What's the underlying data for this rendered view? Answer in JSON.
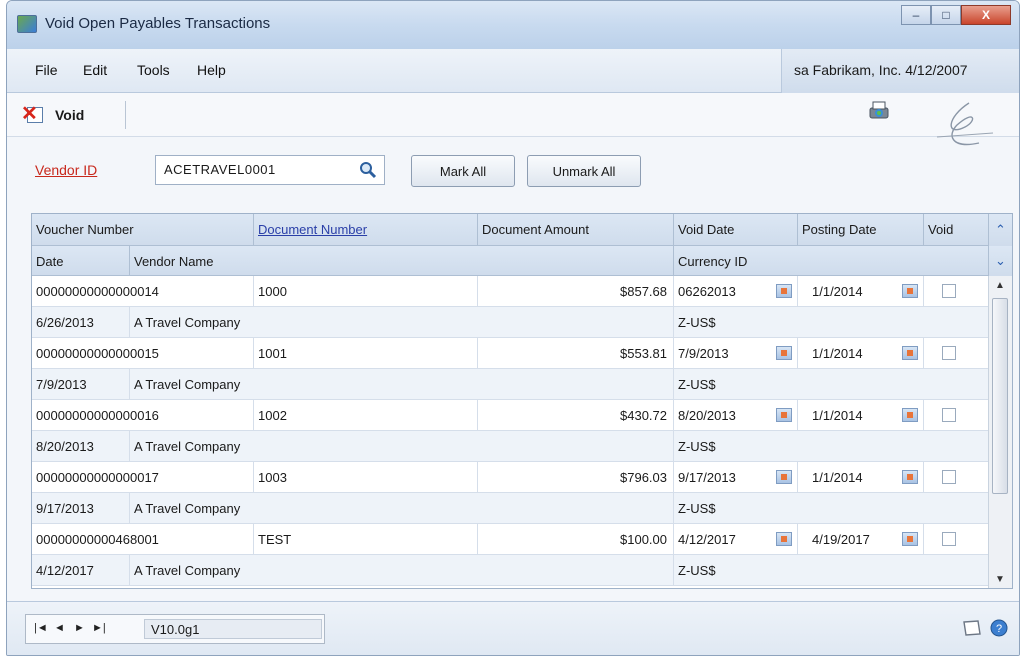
{
  "window": {
    "title": "Void Open Payables Transactions",
    "controls": {
      "minimize": "–",
      "maximize": "□",
      "close": "X"
    }
  },
  "menu": {
    "items": [
      "File",
      "Edit",
      "Tools",
      "Help"
    ],
    "company_info": "sa  Fabrikam, Inc.  4/12/2007"
  },
  "toolbar": {
    "void_label": "Void"
  },
  "vendor": {
    "label": "Vendor ID",
    "value": "ACETRAVEL0001",
    "mark_all": "Mark All",
    "unmark_all": "Unmark All"
  },
  "grid": {
    "header1": [
      "Voucher Number",
      "Document Number",
      "Document Amount",
      "Void Date",
      "Posting Date",
      "Void"
    ],
    "header2": [
      "Date",
      "Vendor Name",
      "Currency ID"
    ],
    "rows": [
      {
        "voucher": "00000000000000014",
        "document": "1000",
        "amount": "$857.68",
        "void_date": "06262013",
        "posting_date": "1/1/2014",
        "date": "6/26/2013",
        "vendor_name": "A Travel Company",
        "currency": "Z-US$"
      },
      {
        "voucher": "00000000000000015",
        "document": "1001",
        "amount": "$553.81",
        "void_date": "7/9/2013",
        "posting_date": "1/1/2014",
        "date": "7/9/2013",
        "vendor_name": "A Travel Company",
        "currency": "Z-US$"
      },
      {
        "voucher": "00000000000000016",
        "document": "1002",
        "amount": "$430.72",
        "void_date": "8/20/2013",
        "posting_date": "1/1/2014",
        "date": "8/20/2013",
        "vendor_name": "A Travel Company",
        "currency": "Z-US$"
      },
      {
        "voucher": "00000000000000017",
        "document": "1003",
        "amount": "$796.03",
        "void_date": "9/17/2013",
        "posting_date": "1/1/2014",
        "date": "9/17/2013",
        "vendor_name": "A Travel Company",
        "currency": "Z-US$"
      },
      {
        "voucher": "00000000000468001",
        "document": "TEST",
        "amount": "$100.00",
        "void_date": "4/12/2017",
        "posting_date": "4/19/2017",
        "date": "4/12/2017",
        "vendor_name": "A Travel Company",
        "currency": "Z-US$"
      }
    ]
  },
  "status": {
    "nav": {
      "first": "|◄",
      "prev": "◄",
      "next": "►",
      "last": "►|"
    },
    "version": "V10.0g1"
  },
  "colors": {
    "accent": "#2a3fa8",
    "vendor_label": "#c8281c"
  },
  "icons": [
    "app-icon",
    "void-icon",
    "printer-icon",
    "logo",
    "lookup-icon",
    "calendar-icon",
    "note-icon",
    "help-icon"
  ]
}
